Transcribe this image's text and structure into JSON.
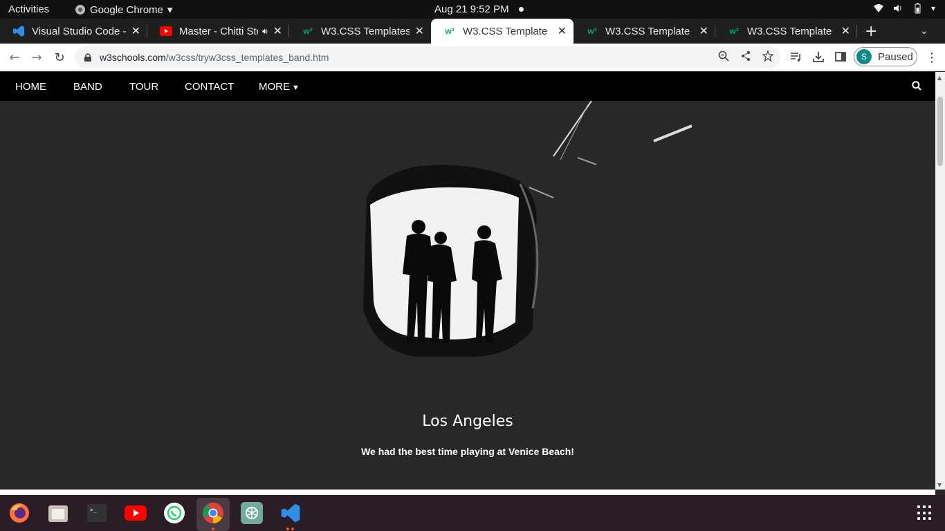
{
  "system_bar": {
    "activities": "Activities",
    "app_name": "Google Chrome",
    "clock": "Aug 21  9:52 PM"
  },
  "tabs": [
    {
      "title": "Visual Studio Code - ",
      "favicon": "vscode-icon"
    },
    {
      "title": "Master - Chitti Sto",
      "favicon": "youtube-icon"
    },
    {
      "title": "W3.CSS Templates",
      "favicon": "w3schools-icon"
    },
    {
      "title": "W3.CSS Template",
      "favicon": "w3schools-icon",
      "active": true
    },
    {
      "title": "W3.CSS Template",
      "favicon": "w3schools-icon"
    },
    {
      "title": "W3.CSS Template",
      "favicon": "w3schools-icon"
    }
  ],
  "address_bar": {
    "domain": "w3schools.com",
    "path": "/w3css/tryw3css_templates_band.htm"
  },
  "profile": {
    "initial": "S",
    "status": "Paused"
  },
  "site_nav": {
    "home": "HOME",
    "band": "BAND",
    "tour": "TOUR",
    "contact": "CONTACT",
    "more": "MORE"
  },
  "slide": {
    "title": "Los Angeles",
    "text": "We had the best time playing at Venice Beach!"
  },
  "colors": {
    "nav_bg": "#000000",
    "page_bg": "#282828",
    "w3_green": "#04AA6D"
  }
}
